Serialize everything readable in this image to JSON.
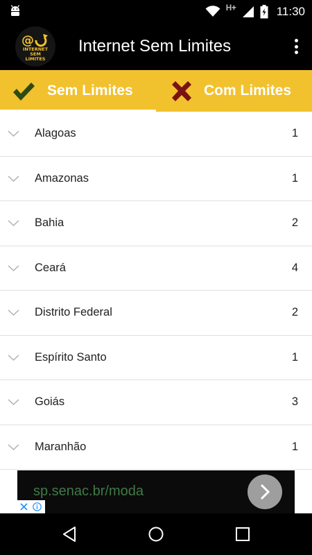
{
  "status_bar": {
    "time": "11:30",
    "network_label": "H+",
    "icons": [
      "android-icon",
      "wifi-icon",
      "signal-icon",
      "battery-icon"
    ]
  },
  "app_bar": {
    "title": "Internet Sem Limites",
    "logo_icon": "internet-sem-limites-logo",
    "menu_icon": "more-vert-icon"
  },
  "tabs": [
    {
      "label": "Sem Limites",
      "icon": "checkmark-icon",
      "icon_color": "#2e4a14",
      "selected": true
    },
    {
      "label": "Com Limites",
      "icon": "x-icon",
      "icon_color": "#7a1212",
      "selected": false
    }
  ],
  "colors": {
    "tab_bar": "#f2c12e",
    "app_bar": "#000000",
    "ad_text": "#3f7a46"
  },
  "states": [
    {
      "name": "Alagoas",
      "count": "1"
    },
    {
      "name": "Amazonas",
      "count": "1"
    },
    {
      "name": "Bahia",
      "count": "2"
    },
    {
      "name": "Ceará",
      "count": "4"
    },
    {
      "name": "Distrito Federal",
      "count": "2"
    },
    {
      "name": "Espírito Santo",
      "count": "1"
    },
    {
      "name": "Goiás",
      "count": "3"
    },
    {
      "name": "Maranhão",
      "count": "1"
    }
  ],
  "ad": {
    "text": "sp.senac.br/moda",
    "button_icon": "chevron-right-icon"
  },
  "nav_bar": {
    "buttons": [
      "back-icon",
      "home-icon",
      "recents-icon"
    ]
  }
}
